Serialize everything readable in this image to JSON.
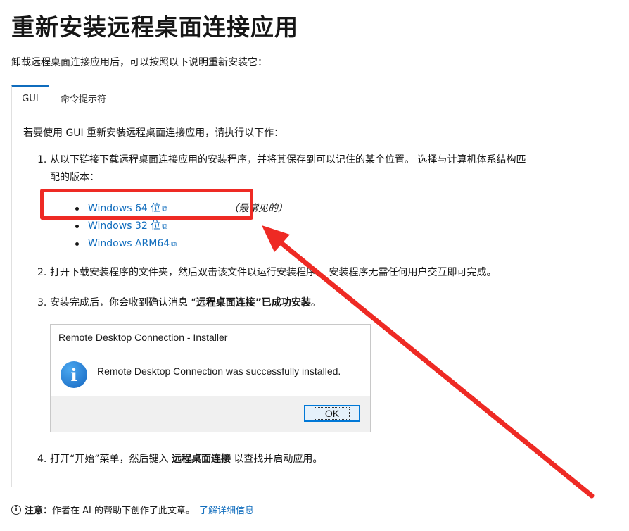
{
  "page": {
    "title": "重新安装远程桌面连接应用",
    "intro": "卸载远程桌面连接应用后，可以按照以下说明重新安装它："
  },
  "tabs": [
    {
      "label": "GUI",
      "active": true
    },
    {
      "label": "命令提示符",
      "active": false
    }
  ],
  "panel": {
    "intro": "若要使用 GUI 重新安装远程桌面连接应用，请执行以下作：",
    "steps": [
      {
        "num": "1.",
        "line1": "从以下链接下载远程桌面连接应用的安装程序，并将其保存到可以记住的某个位置。 选择与计算机体系结构匹",
        "line2": "配的版本："
      },
      {
        "num": "2.",
        "text": "打开下载安装程序的文件夹，然后双击该文件以运行安装程序。 安装程序无需任何用户交互即可完成。"
      },
      {
        "num": "3.",
        "pre": "安装完成后，你会收到确认消息 “",
        "bold": "远程桌面连接",
        "post_bold": "”已成功安装",
        "end": "。"
      },
      {
        "num": "4.",
        "pre": "打开“开始”菜单，然后键入 ",
        "bold": "远程桌面连接",
        "post": " 以查找并启动应用。"
      }
    ],
    "links": [
      {
        "label": "Windows 64 位",
        "ext": "⧉",
        "note": "（最常见的）"
      },
      {
        "label": "Windows 32 位",
        "ext": "⧉"
      },
      {
        "label": "Windows ARM64",
        "ext": "⧉"
      }
    ]
  },
  "dialog": {
    "title": "Remote Desktop Connection - Installer",
    "icon": "i",
    "message": "Remote Desktop Connection was successfully installed.",
    "ok_label": "OK"
  },
  "footer": {
    "icon": "i",
    "label": "注意：",
    "text": "作者在 AI 的帮助下创作了此文章。",
    "link": "了解详细信息"
  },
  "annotation": {
    "color": "#ee2a24"
  }
}
